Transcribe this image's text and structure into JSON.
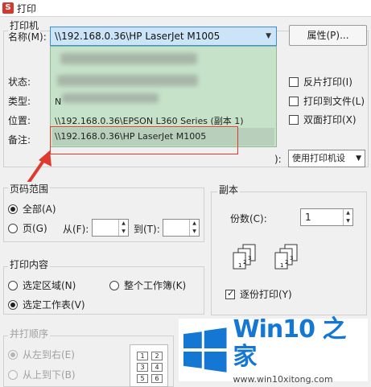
{
  "window": {
    "app_icon": "S",
    "title": "打印"
  },
  "printer_group": {
    "label": "打印机",
    "name_label": "名称(M):",
    "selected_printer": "\\\\192.168.0.36\\HP LaserJet M1005",
    "properties_button": "属性(P)...",
    "status_label": "状态:",
    "type_label": "类型:",
    "location_label": "位置:",
    "comment_label": "备注:",
    "dropdown_items": [
      "\\\\192.168.0.36\\EPSON L360 Series (副本 1)",
      "\\\\192.168.0.36\\HP LaserJet M1005"
    ],
    "partial_text": "N",
    "options": [
      {
        "label": "反片打印(I)",
        "checked": false
      },
      {
        "label": "打印到文件(L)",
        "checked": false
      },
      {
        "label": "双面打印(X)",
        "checked": false
      }
    ],
    "mode_partial": "):",
    "mode_select": "使用打印机设"
  },
  "page_range": {
    "label": "页码范围",
    "all_label": "全部(A)",
    "pages_label": "页(G)",
    "from_label": "从(F):",
    "to_label": "到(T):",
    "selected": "all"
  },
  "copies": {
    "label": "副本",
    "count_label": "份数(C):",
    "count_value": "1",
    "collate_label": "逐份打印(Y)",
    "collate_checked": true
  },
  "print_content": {
    "label": "打印内容",
    "selection_label": "选定区域(N)",
    "workbook_label": "整个工作簿(K)",
    "sheet_label": "选定工作表(V)",
    "selected": "sheet"
  },
  "print_order": {
    "label": "并打顺序",
    "left_right_label": "从左到右(E)",
    "top_bottom_label": "从上到下(B)",
    "selected": "left_right",
    "cells": [
      "1",
      "2",
      "3",
      "4",
      "5",
      "6"
    ]
  },
  "watermark": {
    "title_latin": "Win10",
    "title_cn": "之家",
    "url": "www.win10xitong.com",
    "colors": {
      "blue": "#1477d4"
    }
  },
  "colors": {
    "selection_bg": "#cce4f7",
    "dropdown_bg": "#c6e3c9",
    "annotation_red": "#e03a2f"
  }
}
